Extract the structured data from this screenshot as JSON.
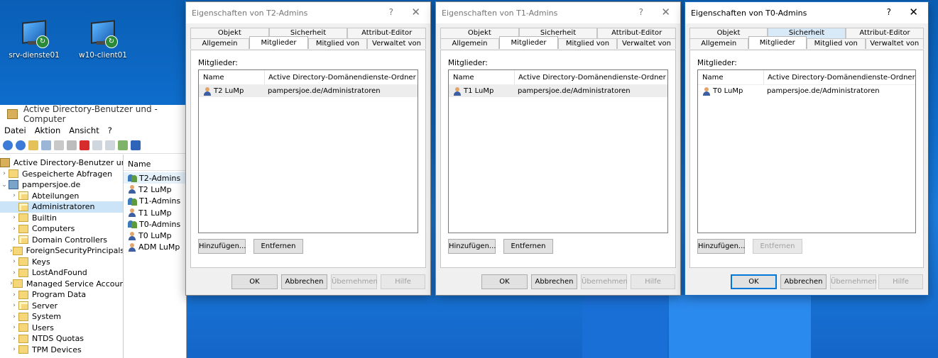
{
  "desktop": {
    "icons": [
      {
        "label": "srv-dienste01"
      },
      {
        "label": "w10-client01"
      }
    ]
  },
  "aduc": {
    "title": "Active Directory-Benutzer und -Computer",
    "menu": [
      "Datei",
      "Aktion",
      "Ansicht",
      "?"
    ],
    "tree": [
      {
        "label": "Active Directory-Benutzer und -",
        "kind": "root"
      },
      {
        "label": "Gespeicherte Abfragen",
        "kind": "folder"
      },
      {
        "label": "pampersjoe.de",
        "kind": "domain"
      },
      {
        "label": "Abteilungen",
        "kind": "ou"
      },
      {
        "label": "Administratoren",
        "kind": "ou"
      },
      {
        "label": "Builtin",
        "kind": "folder"
      },
      {
        "label": "Computers",
        "kind": "folder"
      },
      {
        "label": "Domain Controllers",
        "kind": "ou"
      },
      {
        "label": "ForeignSecurityPrincipals",
        "kind": "folder"
      },
      {
        "label": "Keys",
        "kind": "folder"
      },
      {
        "label": "LostAndFound",
        "kind": "folder"
      },
      {
        "label": "Managed Service Accour",
        "kind": "folder"
      },
      {
        "label": "Program Data",
        "kind": "folder"
      },
      {
        "label": "Server",
        "kind": "ou"
      },
      {
        "label": "System",
        "kind": "folder"
      },
      {
        "label": "Users",
        "kind": "folder"
      },
      {
        "label": "NTDS Quotas",
        "kind": "folder"
      },
      {
        "label": "TPM Devices",
        "kind": "folder"
      }
    ],
    "list_header": "Name",
    "list": [
      {
        "label": "T2-Admins",
        "kind": "group"
      },
      {
        "label": "T2 LuMp",
        "kind": "user"
      },
      {
        "label": "T1-Admins",
        "kind": "group"
      },
      {
        "label": "T1 LuMp",
        "kind": "user"
      },
      {
        "label": "T0-Admins",
        "kind": "group"
      },
      {
        "label": "T0 LuMp",
        "kind": "user"
      },
      {
        "label": "ADM LuMp",
        "kind": "user"
      }
    ]
  },
  "dialogs": [
    {
      "title": "Eigenschaften von T2-Admins",
      "help": "?",
      "close": "✕",
      "tabs_top": [
        "Objekt",
        "Sicherheit",
        "Attribut-Editor"
      ],
      "tabs_bottom": [
        "Allgemein",
        "Mitglieder",
        "Mitglied von",
        "Verwaltet von"
      ],
      "members_label": "Mitglieder:",
      "col_name": "Name",
      "col_folder": "Active Directory-Domänendienste-Ordner",
      "members": [
        {
          "name": "T2 LuMp",
          "folder": "pampersjoe.de/Administratoren"
        }
      ],
      "add": "Hinzufügen...",
      "remove": "Entfernen",
      "ok": "OK",
      "cancel": "Abbrechen",
      "apply": "Übernehmen",
      "helpbtn": "Hilfe"
    },
    {
      "title": "Eigenschaften von T1-Admins",
      "help": "?",
      "close": "✕",
      "tabs_top": [
        "Objekt",
        "Sicherheit",
        "Attribut-Editor"
      ],
      "tabs_bottom": [
        "Allgemein",
        "Mitglieder",
        "Mitglied von",
        "Verwaltet von"
      ],
      "members_label": "Mitglieder:",
      "col_name": "Name",
      "col_folder": "Active Directory-Domänendienste-Ordner",
      "members": [
        {
          "name": "T1 LuMp",
          "folder": "pampersjoe.de/Administratoren"
        }
      ],
      "add": "Hinzufügen...",
      "remove": "Entfernen",
      "ok": "OK",
      "cancel": "Abbrechen",
      "apply": "Übernehmen",
      "helpbtn": "Hilfe"
    },
    {
      "title": "Eigenschaften von T0-Admins",
      "help": "?",
      "close": "✕",
      "tabs_top": [
        "Objekt",
        "Sicherheit",
        "Attribut-Editor"
      ],
      "tabs_bottom": [
        "Allgemein",
        "Mitglieder",
        "Mitglied von",
        "Verwaltet von"
      ],
      "members_label": "Mitglieder:",
      "col_name": "Name",
      "col_folder": "Active Directory-Domänendienste-Ordner",
      "members": [
        {
          "name": "T0 LuMp",
          "folder": "pampersjoe.de/Administratoren"
        }
      ],
      "add": "Hinzufügen...",
      "remove": "Entfernen",
      "ok": "OK",
      "cancel": "Abbrechen",
      "apply": "Übernehmen",
      "helpbtn": "Hilfe"
    }
  ]
}
